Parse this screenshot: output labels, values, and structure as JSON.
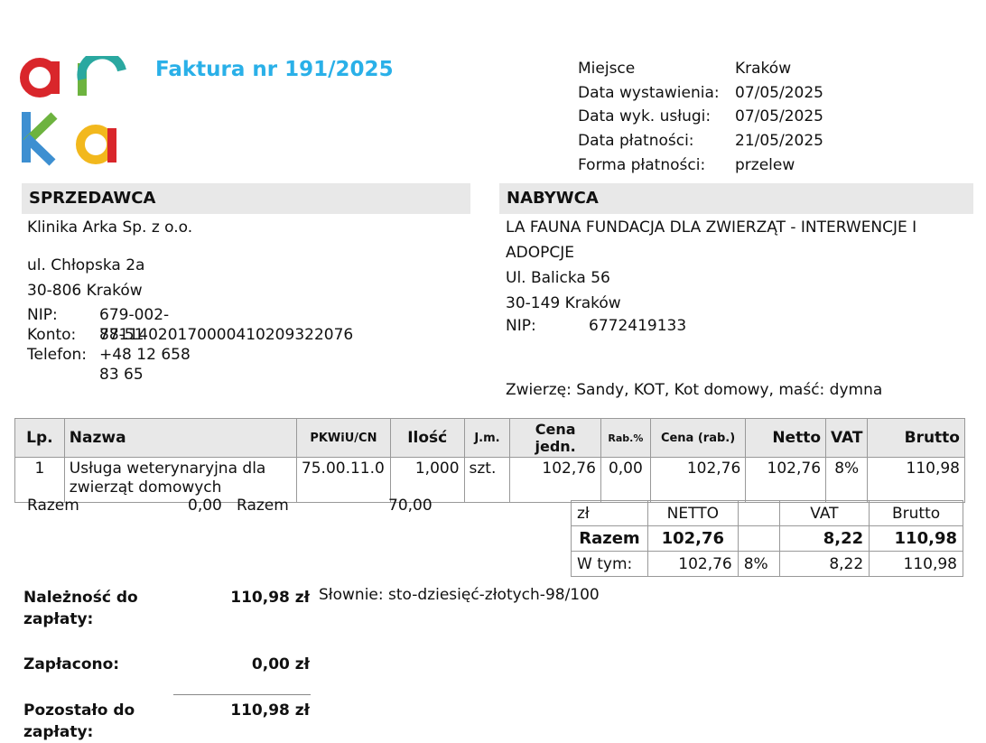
{
  "invoice": {
    "title": "Faktura nr 191/2025"
  },
  "meta": [
    {
      "label": "Miejsce",
      "value": "Kraków"
    },
    {
      "label": "Data wystawienia:",
      "value": "07/05/2025"
    },
    {
      "label": "Data wyk. usługi:",
      "value": "07/05/2025"
    },
    {
      "label": "Data płatności:",
      "value": "21/05/2025"
    },
    {
      "label": "Forma płatności:",
      "value": "przelew"
    }
  ],
  "seller": {
    "heading": "SPRZEDAWCA",
    "name": "Klinika Arka Sp. z o.o.",
    "street": "ul. Chłopska 2a",
    "city": "30-806 Kraków",
    "nip_label": "NIP:",
    "nip": "679-002-77-51",
    "account_label": "Konto:",
    "account": "88114020170000410209322076",
    "phone_label": "Telefon:",
    "phone": "+48 12 658 83 65"
  },
  "buyer": {
    "heading": "NABYWCA",
    "name": "LA FAUNA FUNDACJA DLA ZWIERZĄT - INTERWENCJE I ADOPCJE",
    "street": "Ul. Balicka 56",
    "city": "30-149 Kraków",
    "nip_label": "NIP:",
    "nip": "6772419133",
    "animal": "Zwierzę: Sandy, KOT, Kot domowy, maść: dymna"
  },
  "items_table": {
    "headers": [
      "Lp.",
      "Nazwa",
      "PKWiU/CN",
      "Ilość",
      "J.m.",
      "Cena jedn.",
      "Rab.%",
      "Cena (rab.)",
      "Netto",
      "VAT",
      "Brutto"
    ],
    "rows": [
      [
        "1",
        "Usługa weterynaryjna dla zwierząt domowych",
        "75.00.11.0",
        "1,000",
        "szt.",
        "102,76",
        "0,00",
        "102,76",
        "102,76",
        "8%",
        "110,98"
      ]
    ]
  },
  "razem_line": {
    "label1": "Razem",
    "value1": "0,00",
    "label2": "Razem",
    "value2": "70,00"
  },
  "summary": {
    "header": [
      "zł",
      "NETTO",
      "",
      "VAT",
      "Brutto"
    ],
    "total": [
      "Razem",
      "102,76",
      "",
      "8,22",
      "110,98"
    ],
    "breakdown": [
      "W tym:",
      "102,76",
      "8%",
      "8,22",
      "110,98"
    ]
  },
  "totals": {
    "due_label": "Należność do zapłaty:",
    "due": "110,98 zł",
    "words": "Słownie: sto-dziesięć-złotych-98/100",
    "paid_label": "Zapłacono:",
    "paid": "0,00 zł",
    "remaining_label": "Pozostało do zapłaty:",
    "remaining": "110,98 zł"
  },
  "colors": {
    "title": "#2ab0e8",
    "header_bg": "#e8e8e8",
    "logo_red": "#d9262b",
    "logo_green": "#6db33f",
    "logo_blue": "#3d8fd1",
    "logo_yellow": "#f2b81d"
  }
}
